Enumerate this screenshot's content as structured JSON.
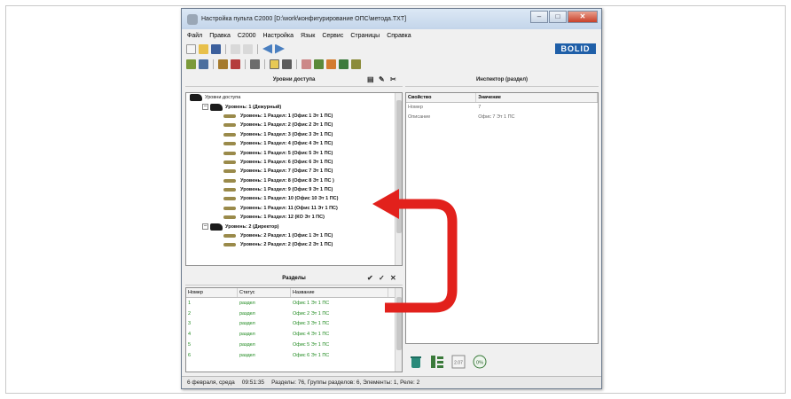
{
  "window": {
    "title": "Настройка пульта С2000 [D:\\work\\конфигурирование ОПС\\метода.TXT]",
    "buttons": {
      "minimize": "–",
      "maximize": "□",
      "close": "✕"
    }
  },
  "menu": [
    "Файл",
    "Правка",
    "С2000",
    "Настройка",
    "Язык",
    "Сервис",
    "Страницы",
    "Справка"
  ],
  "brand": {
    "logo_text": "BOLID",
    "color": "#1f5fa8"
  },
  "access_levels": {
    "header": "Уровни доступа",
    "root": "Уровни доступа",
    "level1_title": "Уровень: 1 (Дежурный)",
    "level1_items": [
      "Уровень: 1 Раздел: 1 (Офис 1 Эт 1 ПС)",
      "Уровень: 1 Раздел: 2 (Офис 2 Эт 1 ПС)",
      "Уровень: 1 Раздел: 3 (Офис 3 Эт 1 ПС)",
      "Уровень: 1 Раздел: 4 (Офис 4 Эт 1 ПС)",
      "Уровень: 1 Раздел: 5 (Офис 5 Эт 1 ПС)",
      "Уровень: 1 Раздел: 6 (Офис 6 Эт 1 ПС)",
      "Уровень: 1 Раздел: 7 (Офис 7 Эт 1 ПС)",
      "Уровень: 1 Раздел: 8 (Офис 8 Эт 1 ПС )",
      "Уровень: 1 Раздел: 9 (Офис 9 Эт 1 ПС)",
      "Уровень: 1 Раздел: 10 (Офис 10 Эт 1 ПС)",
      "Уровень: 1 Раздел: 11 (Офис 11 Эт 1 ПС)",
      "Уровень: 1 Раздел: 12 (КО Эт 1 ПС)"
    ],
    "level2_title": "Уровень: 2 (Директор)",
    "level2_items": [
      "Уровень: 2 Раздел: 1 (Офис 1 Эт 1 ПС)",
      "Уровень: 2 Раздел: 2 (Офис 2 Эт 1 ПС)"
    ]
  },
  "sections": {
    "header": "Разделы",
    "columns": [
      "Номер",
      "Статус",
      "Название"
    ],
    "rows": [
      [
        "1",
        "раздел",
        "Офис 1 Эт 1 ПС"
      ],
      [
        "2",
        "раздел",
        "Офис 2 Эт 1 ПС"
      ],
      [
        "3",
        "раздел",
        "Офис 3 Эт 1 ПС"
      ],
      [
        "4",
        "раздел",
        "Офис 4 Эт 1 ПС"
      ],
      [
        "5",
        "раздел",
        "Офис 5 Эт 1 ПС"
      ],
      [
        "6",
        "раздел",
        "Офис 6 Эт 1 ПС"
      ]
    ],
    "row_color": "#1f8a1f"
  },
  "inspector": {
    "header": "Инспектор (раздел)",
    "columns": [
      "Свойство",
      "Значение"
    ],
    "rows": [
      [
        "Номер",
        "7"
      ],
      [
        "Описание",
        "Офис 7 Эт 1 ПС"
      ]
    ],
    "bottom_badges": {
      "version": "2.07",
      "percent": "0%"
    }
  },
  "statusbar": {
    "date": "6 февраля, среда",
    "time": "09:51:35",
    "summary": "Разделы: 76, Группы разделов: 6, Элементы: 1, Реле: 2"
  },
  "annotation": {
    "arrow_color": "#e2211c"
  }
}
